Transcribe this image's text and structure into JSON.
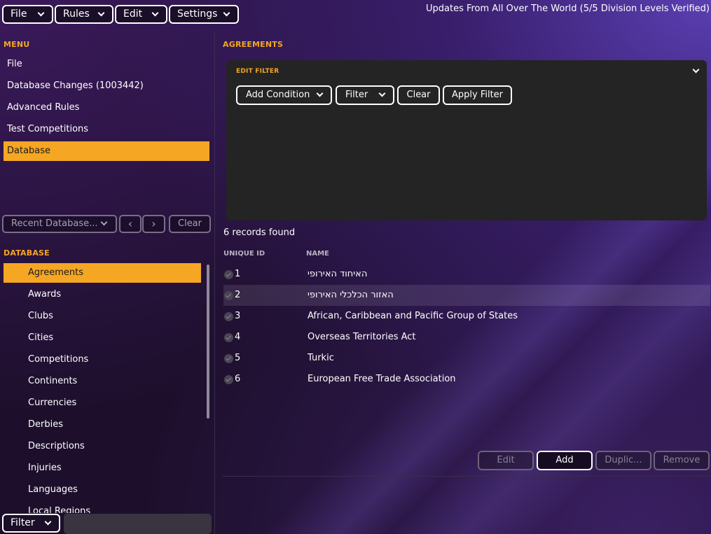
{
  "topbar": {
    "menus": [
      "File",
      "Rules",
      "Edit",
      "Settings"
    ],
    "status": "Updates From All Over The World (5/5 Division Levels Verified)"
  },
  "menu": {
    "heading": "MENU",
    "items": [
      {
        "label": "File"
      },
      {
        "label": "Database Changes (1003442)"
      },
      {
        "label": "Advanced Rules"
      },
      {
        "label": "Test Competitions"
      },
      {
        "label": "Database"
      }
    ]
  },
  "recent": {
    "label": "Recent Database...",
    "prev": "‹",
    "next": "›",
    "clear": "Clear"
  },
  "database": {
    "heading": "DATABASE",
    "items": [
      {
        "label": "Agreements"
      },
      {
        "label": "Awards"
      },
      {
        "label": "Clubs"
      },
      {
        "label": "Cities"
      },
      {
        "label": "Competitions"
      },
      {
        "label": "Continents"
      },
      {
        "label": "Currencies"
      },
      {
        "label": "Derbies"
      },
      {
        "label": "Descriptions"
      },
      {
        "label": "Injuries"
      },
      {
        "label": "Languages"
      },
      {
        "label": "Local Regions"
      }
    ]
  },
  "bottom_left": {
    "filter_label": "Filter",
    "search_placeholder": ""
  },
  "agreements": {
    "heading": "AGREEMENTS",
    "edit_filter": {
      "heading": "EDIT FILTER",
      "add_condition": "Add Condition",
      "filter": "Filter",
      "clear": "Clear",
      "apply": "Apply Filter"
    },
    "records_found": "6 records found",
    "columns": {
      "id": "UNIQUE ID",
      "name": "NAME"
    },
    "rows": [
      {
        "id": "1",
        "name": "האיחוד האירופי"
      },
      {
        "id": "2",
        "name": "האזור הכלכלי האירופי"
      },
      {
        "id": "3",
        "name": "African, Caribbean and Pacific Group of States"
      },
      {
        "id": "4",
        "name": "Overseas Territories Act"
      },
      {
        "id": "5",
        "name": "Turkic"
      },
      {
        "id": "6",
        "name": "European Free Trade Association"
      }
    ],
    "actions": {
      "edit": "Edit",
      "add": "Add",
      "duplicate": "Duplic...",
      "remove": "Remove"
    }
  },
  "colors": {
    "accent": "#f5a623",
    "panel": "#242424"
  }
}
